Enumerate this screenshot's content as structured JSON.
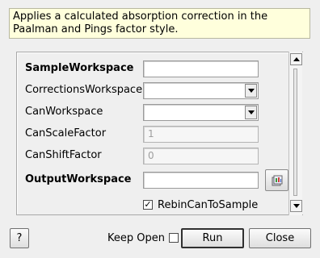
{
  "description": "Applies a calculated absorption correction in the Paalman and Pings factor style.",
  "properties": [
    {
      "name": "SampleWorkspace",
      "bold": true,
      "value": ""
    },
    {
      "name": "CorrectionsWorkspace",
      "bold": false,
      "value": ""
    },
    {
      "name": "CanWorkspace",
      "bold": false,
      "value": ""
    },
    {
      "name": "CanScaleFactor",
      "bold": false,
      "value": "1"
    },
    {
      "name": "CanShiftFactor",
      "bold": false,
      "value": "0"
    },
    {
      "name": "OutputWorkspace",
      "bold": true,
      "value": ""
    }
  ],
  "rebin": {
    "label": "RebinCanToSample",
    "checked": true,
    "check_mark": "✓"
  },
  "footer": {
    "help_label": "?",
    "keep_open_label": "Keep Open",
    "keep_open_checked": false,
    "run_label": "Run",
    "close_label": "Close"
  },
  "icons": {
    "combo_arrow": "chevron-down-icon",
    "browse": "workspace-browse-icon",
    "scroll_up": "scroll-up-icon",
    "scroll_down": "scroll-down-icon"
  }
}
